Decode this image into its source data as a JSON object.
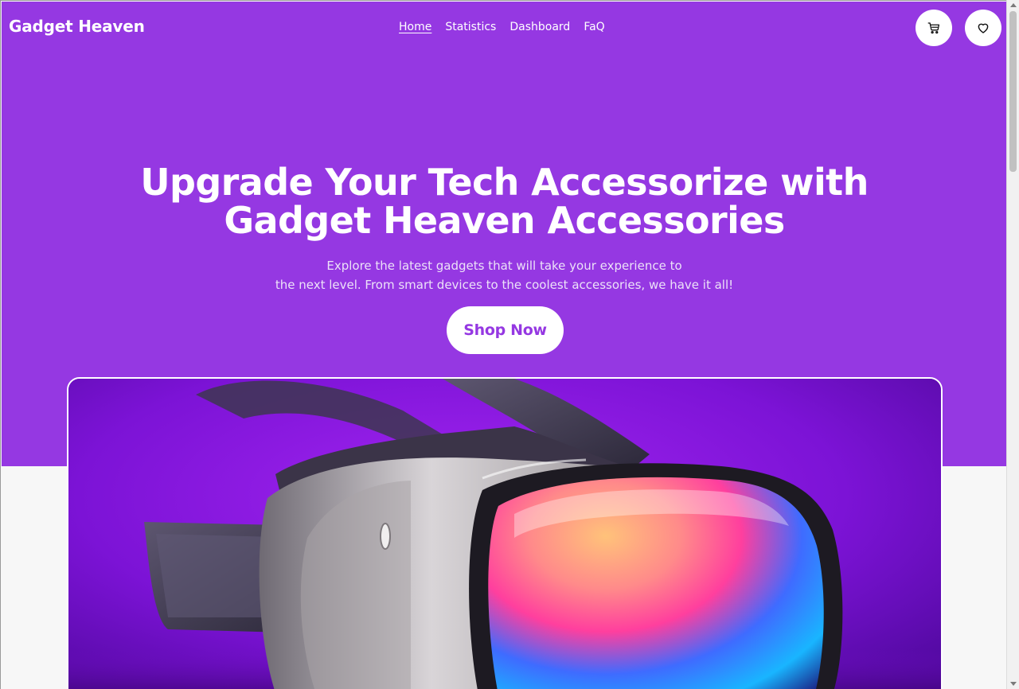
{
  "header": {
    "brand": "Gadget Heaven",
    "nav": [
      {
        "label": "Home",
        "active": true
      },
      {
        "label": "Statistics",
        "active": false
      },
      {
        "label": "Dashboard",
        "active": false
      },
      {
        "label": "FaQ",
        "active": false
      }
    ],
    "icons": {
      "cart": "cart-icon",
      "wishlist": "heart-icon"
    }
  },
  "hero": {
    "title_line1": "Upgrade Your Tech Accessorize with",
    "title_line2": "Gadget Heaven Accessories",
    "subtitle_line1": "Explore the latest gadgets that will take your experience to",
    "subtitle_line2": "the next level. From smart devices to the coolest accessories, we have it all!",
    "cta_label": "Shop Now"
  },
  "banner": {
    "image": "vr-headset-image"
  },
  "colors": {
    "brand_purple": "#9538e2",
    "background": "#f7f7f7",
    "white": "#ffffff"
  }
}
